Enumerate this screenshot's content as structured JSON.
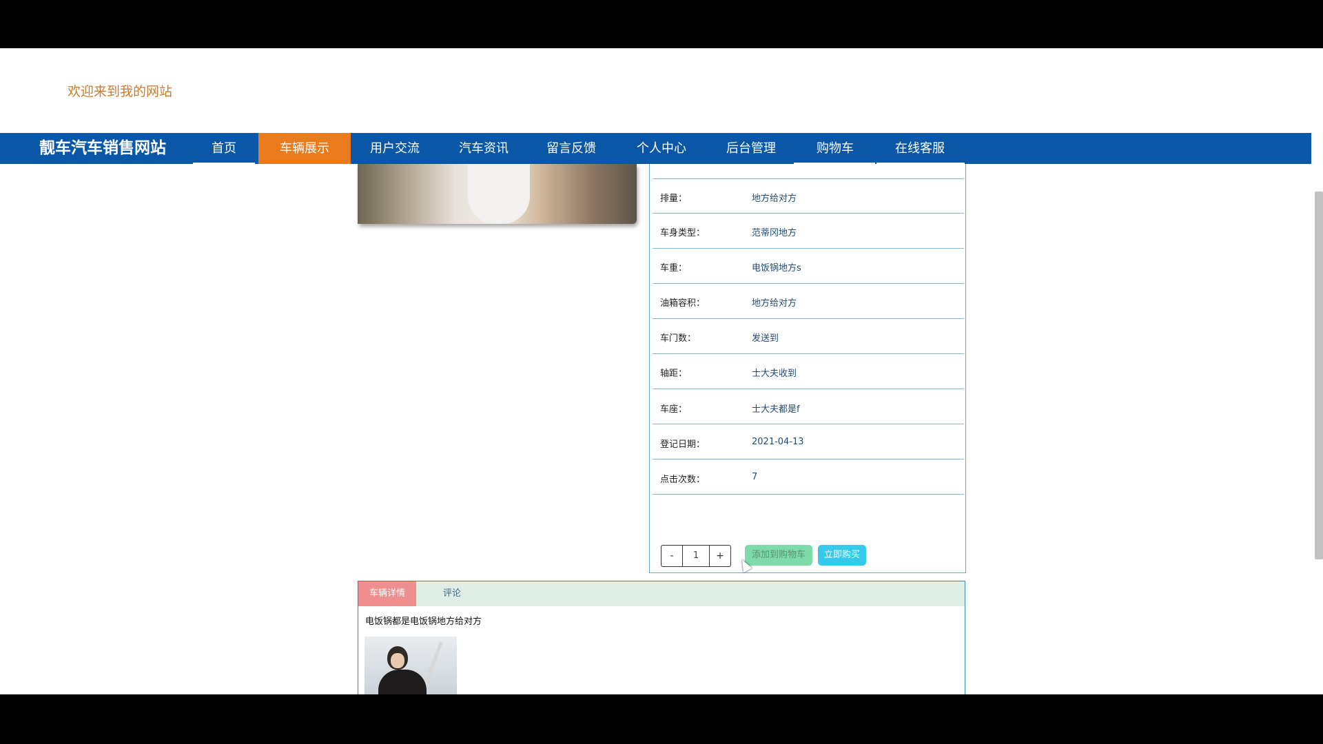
{
  "header": {
    "welcome": "欢迎来到我的网站"
  },
  "nav": {
    "brand": "靓车汽车销售网站",
    "items": [
      {
        "label": "首页"
      },
      {
        "label": "车辆展示",
        "active": true
      },
      {
        "label": "用户交流"
      },
      {
        "label": "汽车资讯"
      },
      {
        "label": "留言反馈"
      },
      {
        "label": "个人中心"
      },
      {
        "label": "后台管理"
      },
      {
        "label": "购物车"
      },
      {
        "label": "在线客服"
      }
    ]
  },
  "details": [
    {
      "label": "排量：",
      "value": "地方给对方"
    },
    {
      "label": "车身类型：",
      "value": "范蒂冈地方"
    },
    {
      "label": "车重：",
      "value": "电饭锅地方s"
    },
    {
      "label": "油箱容积：",
      "value": "地方给对方"
    },
    {
      "label": "车门数：",
      "value": "发送到"
    },
    {
      "label": "轴距：",
      "value": "士大夫收到"
    },
    {
      "label": "车座：",
      "value": "士大夫都是f"
    },
    {
      "label": "登记日期：",
      "value": "2021-04-13"
    },
    {
      "label": "点击次数：",
      "value": "7"
    }
  ],
  "purchase": {
    "minus": "-",
    "quantity": "1",
    "plus": "+",
    "add_to_cart": "添加到购物车",
    "buy_now": "立即购买"
  },
  "tabs": {
    "detail": "车辆详情",
    "comment": "评论"
  },
  "detail_text": "电饭锅都是电饭锅地方给对方",
  "colors": {
    "nav_bg": "#0a57a8",
    "nav_active": "#ea7b1d",
    "welcome": "#c97b2e",
    "cart_button": "#7ddbaa",
    "buy_button": "#35c9ec",
    "tab_active": "#ee8e8e"
  }
}
